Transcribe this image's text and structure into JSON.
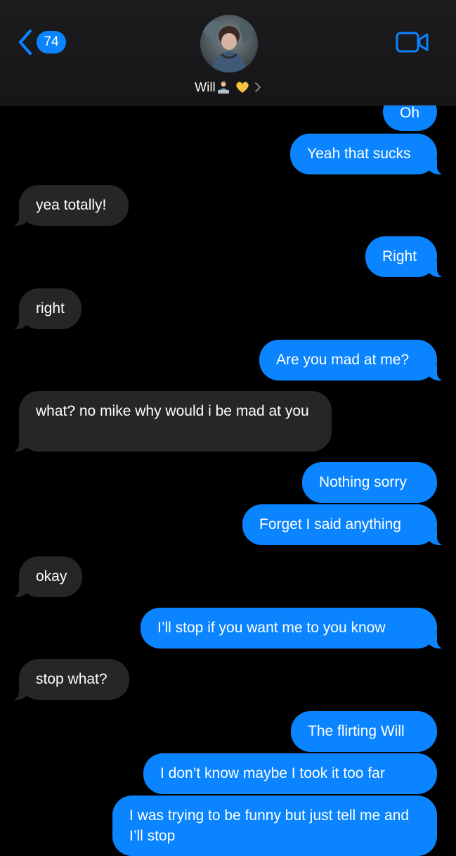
{
  "header": {
    "back_count": "74",
    "contact_name": "Will",
    "heart_color": "#f5c242",
    "accent_color": "#0a84ff"
  },
  "messages": [
    {
      "from": "me",
      "text": "Oh"
    },
    {
      "from": "me",
      "text": "Yeah that sucks"
    },
    {
      "from": "them",
      "text": "yea totally!"
    },
    {
      "from": "me",
      "text": "Right"
    },
    {
      "from": "them",
      "text": "right"
    },
    {
      "from": "me",
      "text": "Are you mad at me?"
    },
    {
      "from": "them",
      "text": "what? no mike why would i be mad at you"
    },
    {
      "from": "me",
      "text": "Nothing sorry"
    },
    {
      "from": "me",
      "text": "Forget I said anything"
    },
    {
      "from": "them",
      "text": "okay"
    },
    {
      "from": "me",
      "text": "I’ll stop if you want me to you know"
    },
    {
      "from": "them",
      "text": "stop what?"
    },
    {
      "from": "me",
      "text": "The flirting Will"
    },
    {
      "from": "me",
      "text": "I don’t know maybe I took it too far"
    },
    {
      "from": "me",
      "text": "I was trying to be funny but just tell me and I’ll stop"
    }
  ]
}
